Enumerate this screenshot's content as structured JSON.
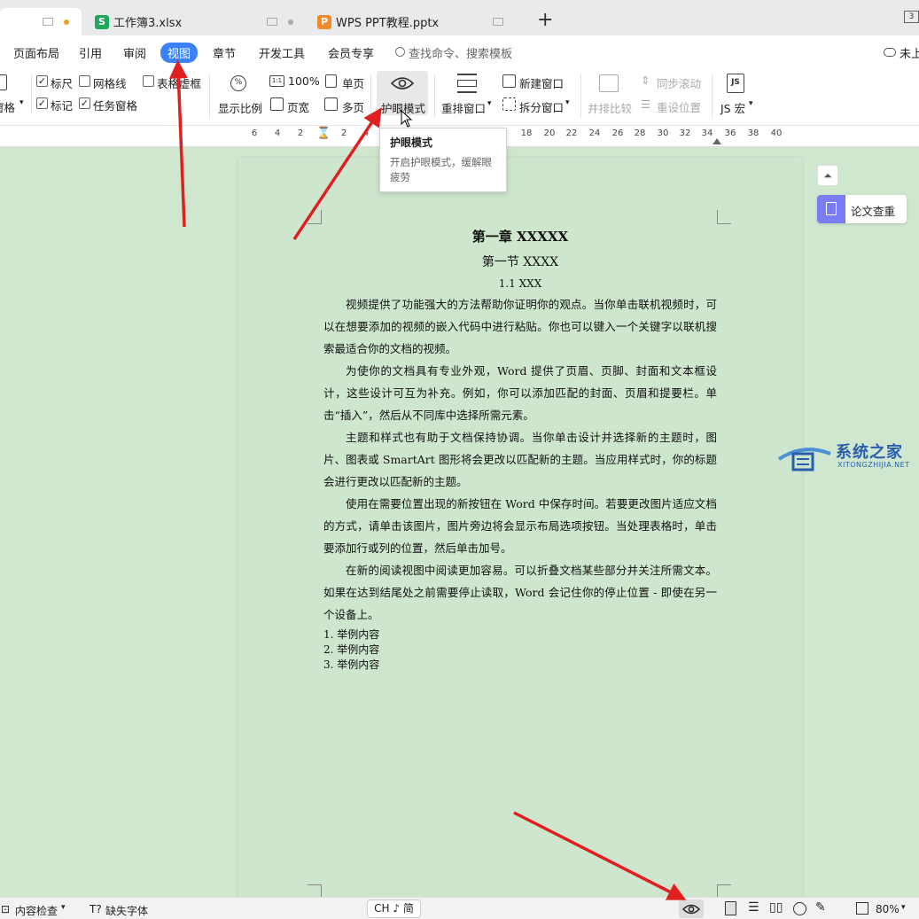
{
  "tabs": [
    {
      "label": "",
      "active": true
    },
    {
      "label": "工作簿3.xlsx",
      "icon": "S",
      "icon_color": "#1fa95b"
    },
    {
      "label": "WPS PPT教程.pptx",
      "icon": "P",
      "icon_color": "#f08c2b"
    }
  ],
  "tabbar": {
    "new_tab": "+",
    "window_badge": "3"
  },
  "menu": {
    "items": [
      "页面布局",
      "引用",
      "审阅",
      "视图",
      "章节",
      "开发工具",
      "会员专享"
    ],
    "active": "视图",
    "search_placeholder": "查找命令、搜索模板",
    "cloud_label": "未上"
  },
  "ribbon": {
    "nav_pane": "窗格",
    "checkboxes": [
      {
        "label": "标尺",
        "checked": true
      },
      {
        "label": "网格线",
        "checked": false
      },
      {
        "label": "表格虚框",
        "checked": false
      },
      {
        "label": "标记",
        "checked": true
      },
      {
        "label": "任务窗格",
        "checked": true
      }
    ],
    "zoom": "显示比例",
    "hundred": "100%",
    "page_width": "页宽",
    "single_page": "单页",
    "multi_page": "多页",
    "eye_mode": "护眼模式",
    "rearrange": "重排窗口",
    "new_window": "新建窗口",
    "split_window": "拆分窗口",
    "compare": "并排比较",
    "sync_scroll": "同步滚动",
    "reset_position": "重设位置",
    "macro": "JS 宏"
  },
  "ruler": {
    "ticks": [
      "6",
      "4",
      "2",
      "2",
      "4",
      "18",
      "20",
      "22",
      "24",
      "26",
      "28",
      "30",
      "32",
      "34",
      "36",
      "38",
      "40"
    ]
  },
  "tooltip": {
    "title": "护眼模式",
    "description": "开启护眼模式，缓解眼疲劳"
  },
  "document": {
    "h1": "第一章  XXXXX",
    "h2": "第一节  XXXX",
    "h3": "1.1 XXX",
    "paragraphs": [
      "视频提供了功能强大的方法帮助你证明你的观点。当你单击联机视频时，可以在想要添加的视频的嵌入代码中进行粘贴。你也可以键入一个关键字以联机搜索最适合你的文档的视频。",
      "为使你的文档具有专业外观，Word 提供了页眉、页脚、封面和文本框设计，这些设计可互为补充。例如，你可以添加匹配的封面、页眉和提要栏。单击“插入”，然后从不同库中选择所需元素。",
      "主题和样式也有助于文档保持协调。当你单击设计并选择新的主题时，图片、图表或 SmartArt 图形将会更改以匹配新的主题。当应用样式时，你的标题会进行更改以匹配新的主题。",
      "使用在需要位置出现的新按钮在 Word 中保存时间。若要更改图片适应文档的方式，请单击该图片，图片旁边将会显示布局选项按钮。当处理表格时，单击要添加行或列的位置，然后单击加号。",
      "在新的阅读视图中阅读更加容易。可以折叠文档某些部分并关注所需文本。如果在达到结尾处之前需要停止读取，Word 会记住你的停止位置 - 即使在另一个设备上。"
    ],
    "list": [
      "1. 举例内容",
      "2. 举例内容",
      "3. 举例内容"
    ]
  },
  "side_panel": {
    "thesis_check": "论文查重"
  },
  "watermark": {
    "name": "系统之家",
    "url": "XITONGZHIJIA.NET"
  },
  "status": {
    "content_check": "内容检查",
    "missing_fonts": "缺失字体",
    "language": "CH ♪ 简",
    "zoom": "80%"
  },
  "colors": {
    "eye_background": "#cde6cd",
    "accent": "#3b82f6",
    "arrow": "#e02020"
  }
}
